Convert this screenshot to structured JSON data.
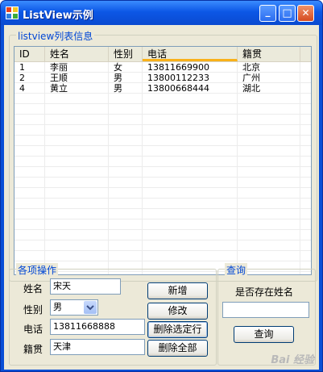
{
  "window": {
    "title": "ListView示例",
    "minimize_glyph": "_",
    "maximize_glyph": "□",
    "close_glyph": "✕"
  },
  "listview_group": {
    "legend": "listview列表信息"
  },
  "listview": {
    "columns": [
      "ID",
      "姓名",
      "性别",
      "电话",
      "籍贯"
    ],
    "rows": [
      [
        "1",
        "李丽",
        "女",
        "13811669900",
        "北京"
      ],
      [
        "2",
        "王顺",
        "男",
        "13800112233",
        "广州"
      ],
      [
        "4",
        "黄立",
        "男",
        "13800668444",
        "湖北"
      ]
    ]
  },
  "ops": {
    "legend": "各项操作",
    "name_label": "姓名",
    "name_value": "宋天",
    "gender_label": "性别",
    "gender_value": "男",
    "phone_label": "电话",
    "phone_value": "13811668888",
    "origin_label": "籍贯",
    "origin_value": "天津",
    "add_button": "新增",
    "edit_button": "修改",
    "delete_selected_button": "删除选定行",
    "delete_all_button": "删除全部"
  },
  "query": {
    "legend": "查询",
    "question": "是否存在姓名",
    "input_value": "",
    "query_button": "查询"
  },
  "watermark": "Bai 经验",
  "colors": {
    "titlebar": "#0c57e6",
    "group_legend": "#0046d5",
    "header_selected": "#f9b119"
  }
}
